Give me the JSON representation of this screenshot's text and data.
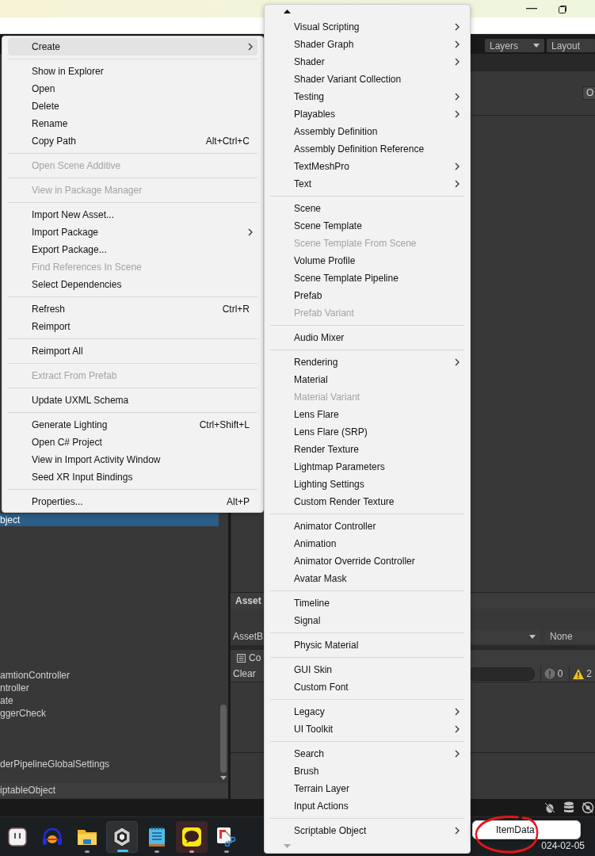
{
  "toolbar": {
    "layers": "Layers",
    "layout": "Layout"
  },
  "scene_panel": {
    "button": "O"
  },
  "project": {
    "items": [
      {
        "label": "bject",
        "selected": true
      },
      {
        "label": "amtionController",
        "selected": false
      },
      {
        "label": "ntroller",
        "selected": false
      },
      {
        "label": "ate",
        "selected": false
      },
      {
        "label": "ggerCheck",
        "selected": false
      },
      {
        "label": "derPipelineGlobalSettings",
        "selected": false
      }
    ],
    "path": "iptableObject"
  },
  "asset_panel": {
    "title": "Asset",
    "bundle_label": "AssetB",
    "variant": "None"
  },
  "console": {
    "title": "Co",
    "clear": "Clear",
    "error_count": "0",
    "warning_count": "2"
  },
  "context_menu": {
    "items": [
      {
        "kind": "item",
        "label": "Create",
        "submenu": true,
        "disabled": false,
        "selected": true
      },
      {
        "kind": "separator"
      },
      {
        "kind": "item",
        "label": "Show in Explorer",
        "submenu": false,
        "disabled": false,
        "selected": false
      },
      {
        "kind": "item",
        "label": "Open",
        "submenu": false,
        "disabled": false,
        "selected": false
      },
      {
        "kind": "item",
        "label": "Delete",
        "submenu": false,
        "disabled": false,
        "selected": false
      },
      {
        "kind": "item",
        "label": "Rename",
        "submenu": false,
        "disabled": false,
        "selected": false
      },
      {
        "kind": "item",
        "label": "Copy Path",
        "shortcut": "Alt+Ctrl+C",
        "submenu": false,
        "disabled": false,
        "selected": false
      },
      {
        "kind": "separator"
      },
      {
        "kind": "item",
        "label": "Open Scene Additive",
        "submenu": false,
        "disabled": true,
        "selected": false
      },
      {
        "kind": "separator"
      },
      {
        "kind": "item",
        "label": "View in Package Manager",
        "submenu": false,
        "disabled": true,
        "selected": false
      },
      {
        "kind": "separator"
      },
      {
        "kind": "item",
        "label": "Import New Asset...",
        "submenu": false,
        "disabled": false,
        "selected": false
      },
      {
        "kind": "item",
        "label": "Import Package",
        "submenu": true,
        "disabled": false,
        "selected": false
      },
      {
        "kind": "item",
        "label": "Export Package...",
        "submenu": false,
        "disabled": false,
        "selected": false
      },
      {
        "kind": "item",
        "label": "Find References In Scene",
        "submenu": false,
        "disabled": true,
        "selected": false
      },
      {
        "kind": "item",
        "label": "Select Dependencies",
        "submenu": false,
        "disabled": false,
        "selected": false
      },
      {
        "kind": "separator"
      },
      {
        "kind": "item",
        "label": "Refresh",
        "shortcut": "Ctrl+R",
        "submenu": false,
        "disabled": false,
        "selected": false
      },
      {
        "kind": "item",
        "label": "Reimport",
        "submenu": false,
        "disabled": false,
        "selected": false
      },
      {
        "kind": "separator"
      },
      {
        "kind": "item",
        "label": "Reimport All",
        "submenu": false,
        "disabled": false,
        "selected": false
      },
      {
        "kind": "separator"
      },
      {
        "kind": "item",
        "label": "Extract From Prefab",
        "submenu": false,
        "disabled": true,
        "selected": false
      },
      {
        "kind": "separator"
      },
      {
        "kind": "item",
        "label": "Update UXML Schema",
        "submenu": false,
        "disabled": false,
        "selected": false
      },
      {
        "kind": "separator"
      },
      {
        "kind": "item",
        "label": "Generate Lighting",
        "shortcut": "Ctrl+Shift+L",
        "submenu": false,
        "disabled": false,
        "selected": false
      },
      {
        "kind": "item",
        "label": "Open C# Project",
        "submenu": false,
        "disabled": false,
        "selected": false
      },
      {
        "kind": "item",
        "label": "View in Import Activity Window",
        "submenu": false,
        "disabled": false,
        "selected": false
      },
      {
        "kind": "item",
        "label": "Seed XR Input Bindings",
        "submenu": false,
        "disabled": false,
        "selected": false
      },
      {
        "kind": "separator"
      },
      {
        "kind": "item",
        "label": "Properties...",
        "shortcut": "Alt+P",
        "submenu": false,
        "disabled": false,
        "selected": false
      }
    ]
  },
  "create_menu": {
    "items": [
      {
        "kind": "item",
        "label": "Visual Scripting",
        "submenu": true,
        "disabled": false,
        "selected": false
      },
      {
        "kind": "item",
        "label": "Shader Graph",
        "submenu": true,
        "disabled": false,
        "selected": false
      },
      {
        "kind": "item",
        "label": "Shader",
        "submenu": true,
        "disabled": false,
        "selected": false
      },
      {
        "kind": "item",
        "label": "Shader Variant Collection",
        "submenu": false,
        "disabled": false,
        "selected": false
      },
      {
        "kind": "item",
        "label": "Testing",
        "submenu": true,
        "disabled": false,
        "selected": false
      },
      {
        "kind": "item",
        "label": "Playables",
        "submenu": true,
        "disabled": false,
        "selected": false
      },
      {
        "kind": "item",
        "label": "Assembly Definition",
        "submenu": false,
        "disabled": false,
        "selected": false
      },
      {
        "kind": "item",
        "label": "Assembly Definition Reference",
        "submenu": false,
        "disabled": false,
        "selected": false
      },
      {
        "kind": "item",
        "label": "TextMeshPro",
        "submenu": true,
        "disabled": false,
        "selected": false
      },
      {
        "kind": "item",
        "label": "Text",
        "submenu": true,
        "disabled": false,
        "selected": false
      },
      {
        "kind": "separator"
      },
      {
        "kind": "item",
        "label": "Scene",
        "submenu": false,
        "disabled": false,
        "selected": false
      },
      {
        "kind": "item",
        "label": "Scene Template",
        "submenu": false,
        "disabled": false,
        "selected": false
      },
      {
        "kind": "item",
        "label": "Scene Template From Scene",
        "submenu": false,
        "disabled": true,
        "selected": false
      },
      {
        "kind": "item",
        "label": "Volume Profile",
        "submenu": false,
        "disabled": false,
        "selected": false
      },
      {
        "kind": "item",
        "label": "Scene Template Pipeline",
        "submenu": false,
        "disabled": false,
        "selected": false
      },
      {
        "kind": "item",
        "label": "Prefab",
        "submenu": false,
        "disabled": false,
        "selected": false
      },
      {
        "kind": "item",
        "label": "Prefab Variant",
        "submenu": false,
        "disabled": true,
        "selected": false
      },
      {
        "kind": "separator"
      },
      {
        "kind": "item",
        "label": "Audio Mixer",
        "submenu": false,
        "disabled": false,
        "selected": false
      },
      {
        "kind": "separator"
      },
      {
        "kind": "item",
        "label": "Rendering",
        "submenu": true,
        "disabled": false,
        "selected": false
      },
      {
        "kind": "item",
        "label": "Material",
        "submenu": false,
        "disabled": false,
        "selected": false
      },
      {
        "kind": "item",
        "label": "Material Variant",
        "submenu": false,
        "disabled": true,
        "selected": false
      },
      {
        "kind": "item",
        "label": "Lens Flare",
        "submenu": false,
        "disabled": false,
        "selected": false
      },
      {
        "kind": "item",
        "label": "Lens Flare (SRP)",
        "submenu": false,
        "disabled": false,
        "selected": false
      },
      {
        "kind": "item",
        "label": "Render Texture",
        "submenu": false,
        "disabled": false,
        "selected": false
      },
      {
        "kind": "item",
        "label": "Lightmap Parameters",
        "submenu": false,
        "disabled": false,
        "selected": false
      },
      {
        "kind": "item",
        "label": "Lighting Settings",
        "submenu": false,
        "disabled": false,
        "selected": false
      },
      {
        "kind": "item",
        "label": "Custom Render Texture",
        "submenu": false,
        "disabled": false,
        "selected": false
      },
      {
        "kind": "separator"
      },
      {
        "kind": "item",
        "label": "Animator Controller",
        "submenu": false,
        "disabled": false,
        "selected": false
      },
      {
        "kind": "item",
        "label": "Animation",
        "submenu": false,
        "disabled": false,
        "selected": false
      },
      {
        "kind": "item",
        "label": "Animator Override Controller",
        "submenu": false,
        "disabled": false,
        "selected": false
      },
      {
        "kind": "item",
        "label": "Avatar Mask",
        "submenu": false,
        "disabled": false,
        "selected": false
      },
      {
        "kind": "separator"
      },
      {
        "kind": "item",
        "label": "Timeline",
        "submenu": false,
        "disabled": false,
        "selected": false
      },
      {
        "kind": "item",
        "label": "Signal",
        "submenu": false,
        "disabled": false,
        "selected": false
      },
      {
        "kind": "separator"
      },
      {
        "kind": "item",
        "label": "Physic Material",
        "submenu": false,
        "disabled": false,
        "selected": false
      },
      {
        "kind": "separator"
      },
      {
        "kind": "item",
        "label": "GUI Skin",
        "submenu": false,
        "disabled": false,
        "selected": false
      },
      {
        "kind": "item",
        "label": "Custom Font",
        "submenu": false,
        "disabled": false,
        "selected": false
      },
      {
        "kind": "separator"
      },
      {
        "kind": "item",
        "label": "Legacy",
        "submenu": true,
        "disabled": false,
        "selected": false
      },
      {
        "kind": "item",
        "label": "UI Toolkit",
        "submenu": true,
        "disabled": false,
        "selected": false
      },
      {
        "kind": "separator"
      },
      {
        "kind": "item",
        "label": "Search",
        "submenu": true,
        "disabled": false,
        "selected": false
      },
      {
        "kind": "item",
        "label": "Brush",
        "submenu": false,
        "disabled": false,
        "selected": false
      },
      {
        "kind": "item",
        "label": "Terrain Layer",
        "submenu": false,
        "disabled": false,
        "selected": false
      },
      {
        "kind": "item",
        "label": "Input Actions",
        "submenu": false,
        "disabled": false,
        "selected": false
      },
      {
        "kind": "separator"
      },
      {
        "kind": "item",
        "label": "Scriptable Object",
        "submenu": true,
        "disabled": false,
        "selected": false
      }
    ]
  },
  "scriptable_object_menu": {
    "items": [
      {
        "kind": "item",
        "label": "ItemData",
        "submenu": false,
        "disabled": false,
        "selected": false
      }
    ]
  },
  "taskbar": {
    "apps": [
      {
        "kind": "face",
        "selected": false,
        "running": false,
        "attention": false
      },
      {
        "kind": "headphones",
        "selected": false,
        "running": false,
        "attention": false
      },
      {
        "kind": "folder",
        "selected": false,
        "running": true,
        "attention": false
      },
      {
        "kind": "cube",
        "selected": true,
        "running": true,
        "attention": false
      },
      {
        "kind": "notepad",
        "selected": false,
        "running": true,
        "attention": false
      },
      {
        "kind": "chat",
        "selected": false,
        "running": true,
        "attention": true
      },
      {
        "kind": "snip",
        "selected": false,
        "running": true,
        "attention": false
      }
    ],
    "date": "024-02-05"
  }
}
